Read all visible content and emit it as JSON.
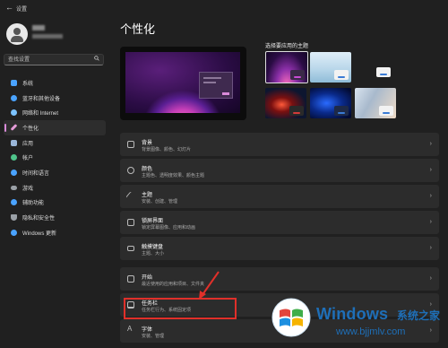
{
  "window": {
    "back_icon": "back-arrow-icon",
    "title": "设置"
  },
  "user": {
    "name": "",
    "email": ""
  },
  "search": {
    "placeholder": "查找设置",
    "icon": "search-icon"
  },
  "sidebar": {
    "items": [
      {
        "label": "系统",
        "icon": "system-icon",
        "color": "#4aa3ff"
      },
      {
        "label": "蓝牙和其他设备",
        "icon": "bluetooth-icon",
        "color": "#4aa3ff"
      },
      {
        "label": "网络和 Internet",
        "icon": "network-icon",
        "color": "#7cc3ff"
      },
      {
        "label": "个性化",
        "icon": "brush-icon",
        "color": "#e39ad6",
        "active": true
      },
      {
        "label": "应用",
        "icon": "apps-icon",
        "color": "#9ab6d8"
      },
      {
        "label": "帐户",
        "icon": "account-icon",
        "color": "#4fc48a"
      },
      {
        "label": "时间和语言",
        "icon": "clock-globe-icon",
        "color": "#4aa3ff"
      },
      {
        "label": "游戏",
        "icon": "game-icon",
        "color": "#9aa0a6"
      },
      {
        "label": "辅助功能",
        "icon": "accessibility-icon",
        "color": "#4aa3ff"
      },
      {
        "label": "隐私和安全性",
        "icon": "shield-icon",
        "color": "#9aa0a6"
      },
      {
        "label": "Windows 更新",
        "icon": "update-icon",
        "color": "#4aa3ff"
      }
    ]
  },
  "main": {
    "title": "个性化",
    "themes_label": "选择要应用的主题",
    "themes": [
      {
        "name": "windows-dark",
        "accent": "#c94cd6",
        "selected": true
      },
      {
        "name": "glow",
        "accent": "#3a7bd5"
      },
      {
        "name": "windows-light",
        "accent": "#3a7bd5"
      },
      {
        "name": "captured-motion",
        "accent": "#d23a3a"
      },
      {
        "name": "flow",
        "accent": "#3a7bd5"
      },
      {
        "name": "sunrise",
        "accent": "#3a7bd5"
      }
    ],
    "cards": [
      {
        "title": "背景",
        "subtitle": "背景图像、颜色、幻灯片",
        "icon": "image-icon"
      },
      {
        "title": "颜色",
        "subtitle": "主题色、透明度效果、颜色主题",
        "icon": "palette-icon"
      },
      {
        "title": "主题",
        "subtitle": "安装、创建、管理",
        "icon": "theme-brush-icon"
      },
      {
        "title": "锁屏界面",
        "subtitle": "锁定屏幕图像、应用和动画",
        "icon": "lock-screen-icon"
      },
      {
        "title": "触摸键盘",
        "subtitle": "主题、大小",
        "icon": "keyboard-icon"
      },
      {
        "title": "开始",
        "subtitle": "最近使用的应用和项目、文件夹",
        "icon": "start-icon"
      },
      {
        "title": "任务栏",
        "subtitle": "任务栏行为、系统固定项",
        "icon": "taskbar-icon"
      },
      {
        "title": "字体",
        "subtitle": "安装、管理",
        "icon": "font-icon"
      }
    ]
  },
  "watermark": {
    "brand": "Windows",
    "brand_cn": "系统之家",
    "url": "www.bjjmlv.com"
  }
}
